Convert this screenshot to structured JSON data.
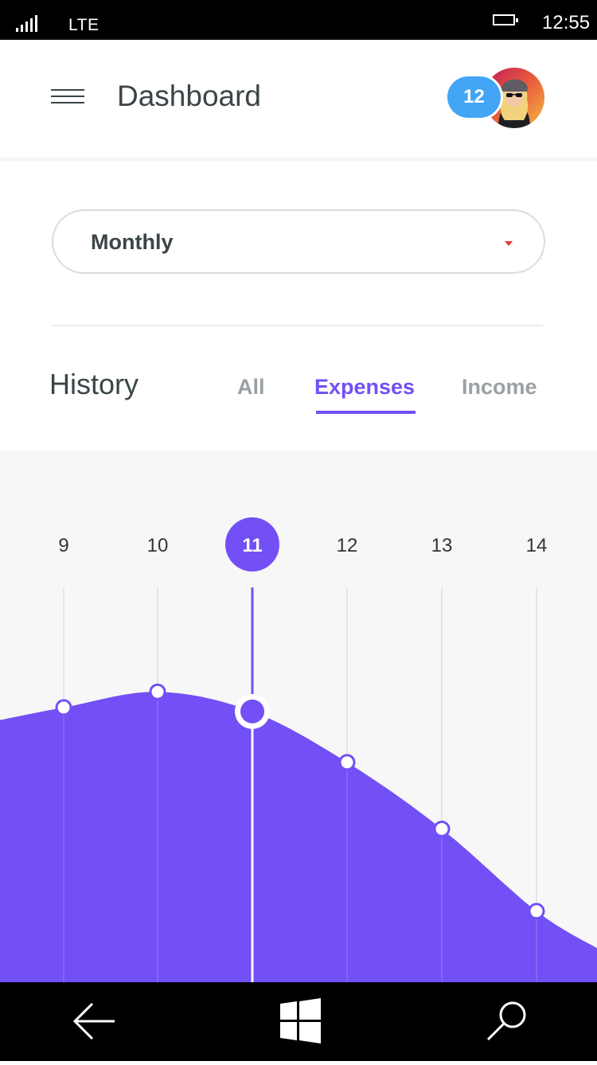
{
  "status_bar": {
    "network": "LTE",
    "time": "12:55"
  },
  "header": {
    "title": "Dashboard",
    "notification_count": "12"
  },
  "filter": {
    "selected": "Monthly"
  },
  "history": {
    "title": "History",
    "tabs": [
      {
        "label": "All",
        "active": false
      },
      {
        "label": "Expenses",
        "active": true
      },
      {
        "label": "Income",
        "active": false
      }
    ]
  },
  "colors": {
    "accent": "#7250f5",
    "badge": "#42a5f5",
    "text": "#3b4548",
    "muted": "#9aa0a3"
  },
  "chart_data": {
    "type": "area",
    "x": [
      "9",
      "10",
      "11",
      "12",
      "13",
      "14"
    ],
    "values": [
      0.62,
      0.66,
      0.61,
      0.48,
      0.31,
      0.1
    ],
    "selected_index": 2,
    "color": "#7250f5"
  },
  "nav": {
    "back_icon": "back-arrow-icon",
    "home_icon": "windows-logo-icon",
    "search_icon": "search-icon"
  }
}
